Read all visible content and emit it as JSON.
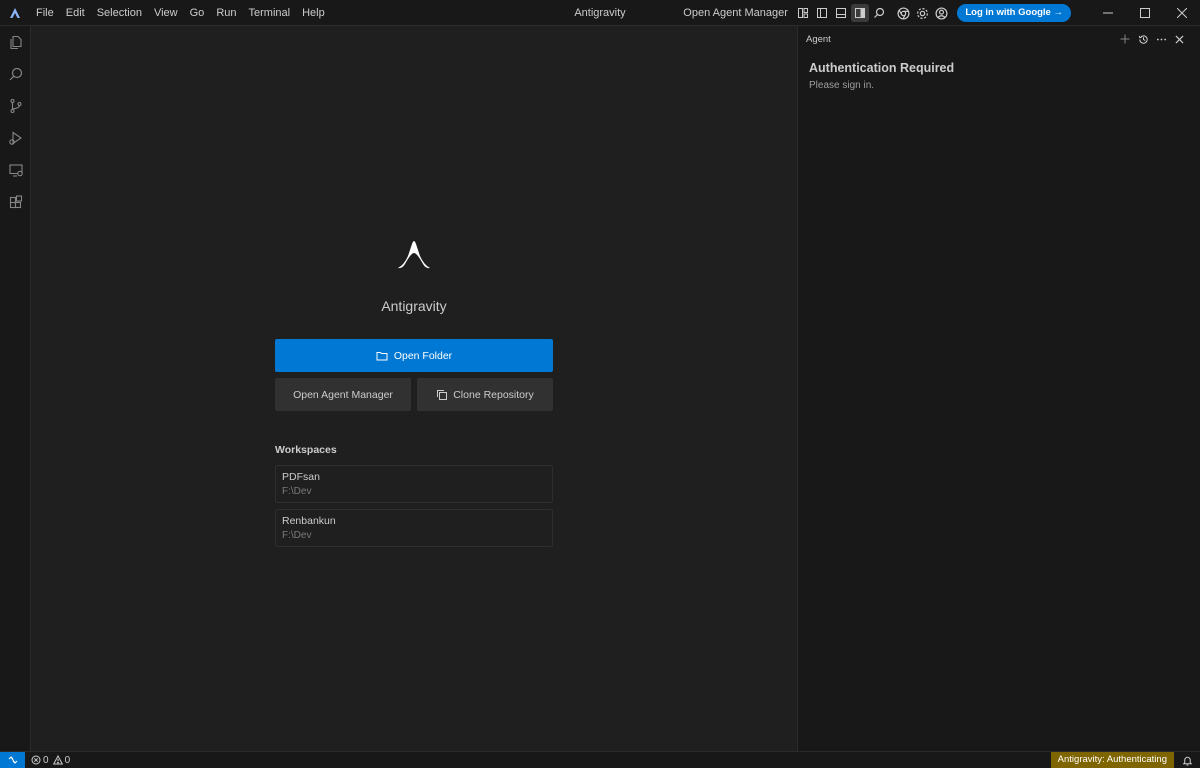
{
  "titlebar": {
    "menu": [
      "File",
      "Edit",
      "Selection",
      "View",
      "Go",
      "Run",
      "Terminal",
      "Help"
    ],
    "title": "Antigravity",
    "agent_manager_label": "Open Agent Manager",
    "login_label": "Log in with Google →",
    "icons": [
      "layout-icon",
      "toggle-sidebar-icon",
      "toggle-panel-icon",
      "toggle-secondary-sidebar-icon",
      "search-icon",
      "chrome-icon",
      "settings-icon",
      "account-icon"
    ]
  },
  "activitybar": {
    "icons": [
      "explorer-icon",
      "search-icon",
      "source-control-icon",
      "run-debug-icon",
      "remote-explorer-icon",
      "extensions-icon"
    ]
  },
  "welcome": {
    "brand_name": "Antigravity",
    "open_folder_label": "Open Folder",
    "open_agent_manager_label": "Open Agent Manager",
    "clone_repo_label": "Clone Repository",
    "workspaces_title": "Workspaces",
    "workspaces": [
      {
        "name": "PDFsan",
        "path": "F:\\Dev"
      },
      {
        "name": "Renbankun",
        "path": "F:\\Dev"
      }
    ]
  },
  "agent_panel": {
    "title": "Agent",
    "auth_title": "Authentication Required",
    "auth_subtitle": "Please sign in."
  },
  "statusbar": {
    "errors": "0",
    "warnings": "0",
    "auth_status": "Antigravity: Authenticating"
  },
  "colors": {
    "accent": "#0078d4",
    "status_warning": "#7f6500",
    "background": "#1f1f1f",
    "sidebar_background": "#181818"
  }
}
